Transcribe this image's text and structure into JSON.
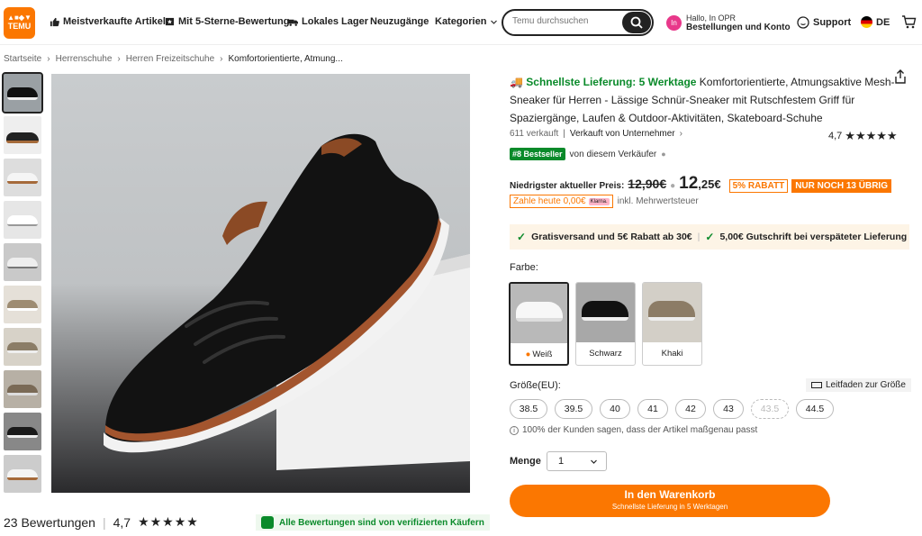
{
  "header": {
    "logo_line1": "TEMU-ICON",
    "logo_line2": "TEMU",
    "nav": [
      {
        "label": "Meistverkaufte Artikel",
        "icon": "thumbs-up-icon"
      },
      {
        "label": "Mit 5-Sterne-Bewertung",
        "icon": "star-badge-icon"
      },
      {
        "label": "Lokales Lager",
        "icon": "truck-icon"
      },
      {
        "label": "Neuzugänge",
        "icon": ""
      },
      {
        "label": "Kategorien",
        "icon": "chevron-down-icon"
      }
    ],
    "search_placeholder": "Temu durchsuchen",
    "account_avatar": "In",
    "account_line1": "Hallo, In OPR",
    "account_line2": "Bestellungen und Konto",
    "support": "Support",
    "language": "DE"
  },
  "breadcrumb": [
    "Startseite",
    "Herrenschuhe",
    "Herren Freizeitschuhe",
    "Komfortorientierte, Atmung..."
  ],
  "gallery": {
    "thumb_count": 10
  },
  "reviews": {
    "count": "23 Bewertungen",
    "rating": "4,7",
    "verified": "Alle Bewertungen sind von verifizierten Käufern"
  },
  "product": {
    "fast_delivery": "Schnellste Lieferung: 5 Werktage",
    "title": "Komfortorientierte, Atmungsaktive Mesh-Sneaker für Herren - Lässige Schnür-Sneaker mit Rutschfestem Griff für Spaziergänge, Laufen & Outdoor-Aktivitäten, Skateboard-Schuhe",
    "sold": "611 verkauft",
    "seller": "Verkauft von Unternehmer",
    "rating": "4,7",
    "bestseller_badge": "#8 Bestseller",
    "bestseller_text": "von diesem Verkäufer"
  },
  "price": {
    "label": "Niedrigster aktueller Preis:",
    "old": "12,90€",
    "now_main": "12",
    "now_cents": ",25€",
    "discount": "5% RABATT",
    "stock": "NUR NOCH 13 ÜBRIG",
    "pay_today": "Zahle heute 0,00€",
    "klarna": "Klarna.",
    "tax": "inkl. Mehrwertsteuer"
  },
  "shipping": {
    "item1": "Gratisversand und 5€ Rabatt ab 30€",
    "item2": "5,00€ Gutschrift bei verspäteter Lieferung"
  },
  "color": {
    "label": "Farbe:",
    "options": [
      "Weiß",
      "Schwarz",
      "Khaki"
    ]
  },
  "size": {
    "label": "Größe(EU):",
    "guide": "Leitfaden zur Größe",
    "options": [
      "38.5",
      "39.5",
      "40",
      "41",
      "42",
      "43",
      "43.5",
      "44.5"
    ],
    "fit_note": "100% der Kunden sagen, dass der Artikel maßgenau passt"
  },
  "quantity": {
    "label": "Menge",
    "value": "1"
  },
  "cart": {
    "label": "In den Warenkorb",
    "sublabel": "Schnellste Lieferung in 5 Werktagen"
  },
  "colors_theme": {
    "accent": "#fb7701",
    "green": "#0a8a2a"
  }
}
